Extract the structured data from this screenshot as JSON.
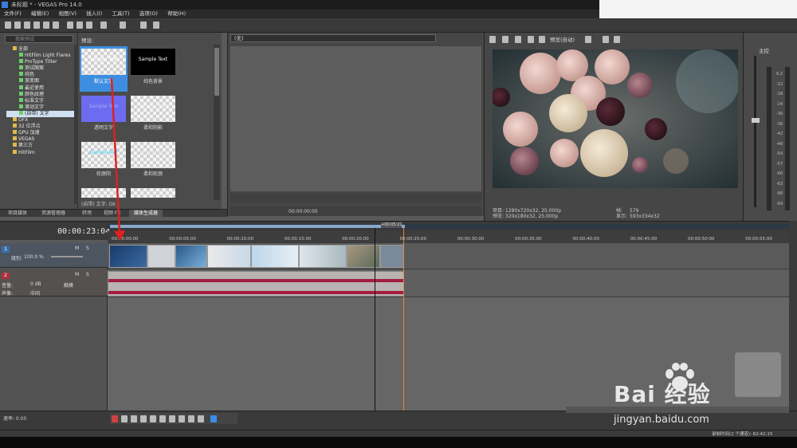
{
  "window": {
    "title": "未标题 * - VEGAS Pro 14.0"
  },
  "menu": [
    "文件(F)",
    "编辑(E)",
    "视图(V)",
    "插入(I)",
    "工具(T)",
    "选项(O)",
    "帮助(H)"
  ],
  "explorer": {
    "search_placeholder": "搜索预设",
    "tree": [
      "全部",
      "HitFilm Light Flares",
      "ProType Titler",
      "测试图案",
      "纯色",
      "渐变图",
      "最近使用",
      "颜色纹理",
      "标准文字",
      "滚动文字",
      "(自带) 文字",
      "OFX",
      "32 位浮点",
      "GPU 加速",
      "VEGAS",
      "第三方",
      "HitFilm"
    ]
  },
  "presets": {
    "title": "预设:",
    "items": [
      {
        "thumb": "Sample Text",
        "label": "默认文字"
      },
      {
        "thumb": "Sample Text",
        "label": "纯色背景"
      },
      {
        "thumb": "Sample Text",
        "label": "透明文字"
      },
      {
        "thumb": "Sample Text",
        "label": "柔和阴影"
      },
      {
        "thumb": "Sample Text",
        "label": "轮廓阴"
      },
      {
        "thumb": "Sample Text",
        "label": "柔和轮廓"
      }
    ],
    "status": "(自带) 文字: OX"
  },
  "tabs": [
    "项目媒体",
    "资源管理器",
    "转场",
    "视频 FX",
    "媒体生成器"
  ],
  "trimmer": {
    "source": "(无)",
    "time": "00:00:00;00"
  },
  "preview": {
    "quality": "预览(自动)",
    "project": "项目: 1280x720x32, 25.000p",
    "preview": "预览: 320x180x32, 25.000p",
    "frame_label": "帧:",
    "frame": "579",
    "display_label": "显示:",
    "display": "593x334x32"
  },
  "master": {
    "label": "主控",
    "scale": [
      "6.2",
      "-12",
      "-18",
      "-24",
      "-30",
      "-36",
      "-42",
      "-48",
      "-54",
      "-57",
      "-60",
      "-63",
      "-66",
      "-69"
    ]
  },
  "timeline": {
    "time": "00:00:23:04",
    "ruler": [
      "00:00:00:00",
      "00:00:05:00",
      "00:00:10:00",
      "00:00:15:00",
      "00:00:20:00",
      "00:00:25:00",
      "00:00:30:00",
      "00:00:35:00",
      "00:00:40:00",
      "00:00:45:00",
      "00:00:50:00",
      "00:00:55:00"
    ],
    "cursor_tag": "+00:05:21",
    "video_track": {
      "num": "1",
      "level_label": "级别:",
      "level": "100.0 %"
    },
    "audio_track": {
      "num": "2",
      "vol_label": "音量:",
      "vol": "0 dB",
      "pan_label": "声像:",
      "pan": "中间",
      "mode": "触摸"
    },
    "rate": "速率: 0.00"
  },
  "statusbar": "录制时间(2 个通道): 62:42:15",
  "watermark": {
    "brand": "Bai 经验",
    "url": "jingyan.baidu.com"
  },
  "colors": {
    "accent": "#3a8ee6",
    "audio_wave": "#a31d3f",
    "arrow": "#e02020"
  }
}
